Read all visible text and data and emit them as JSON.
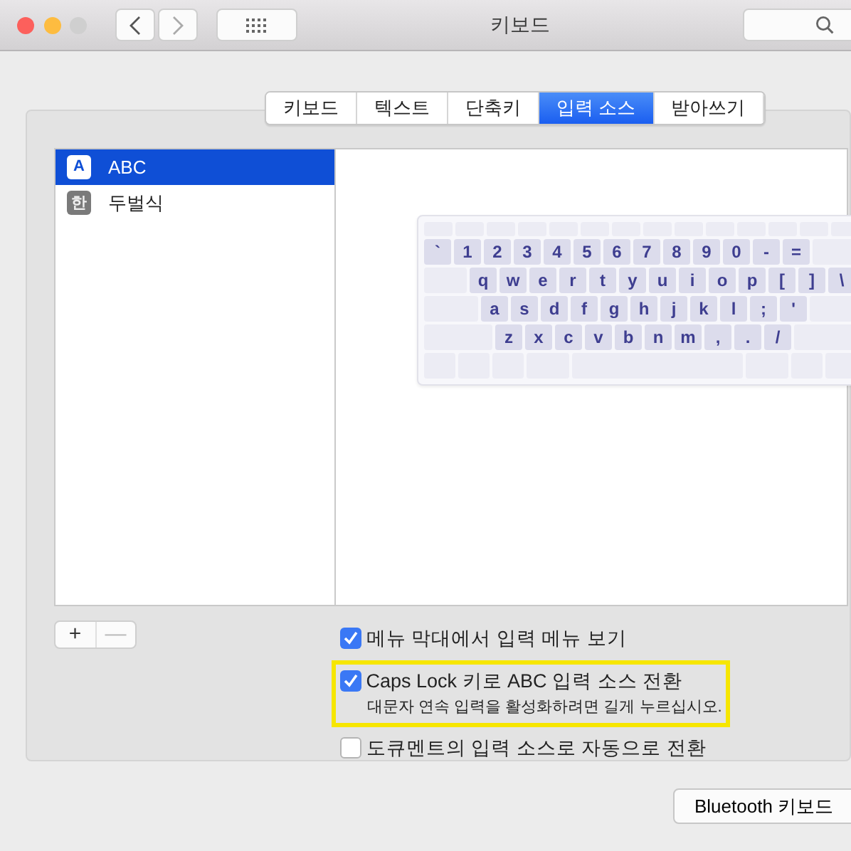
{
  "window": {
    "title": "키보드"
  },
  "tabs": [
    {
      "label": "키보드",
      "selected": false
    },
    {
      "label": "텍스트",
      "selected": false
    },
    {
      "label": "단축키",
      "selected": false
    },
    {
      "label": "입력 소스",
      "selected": true
    },
    {
      "label": "받아쓰기",
      "selected": false
    }
  ],
  "input_sources": [
    {
      "icon": "A",
      "name": "ABC",
      "selected": true
    },
    {
      "icon": "한",
      "name": "두벌식",
      "selected": false
    }
  ],
  "keyboard": {
    "rows": [
      [
        "`",
        "1",
        "2",
        "3",
        "4",
        "5",
        "6",
        "7",
        "8",
        "9",
        "0",
        "-",
        "="
      ],
      [
        "q",
        "w",
        "e",
        "r",
        "t",
        "y",
        "u",
        "i",
        "o",
        "p",
        "[",
        "]",
        "\\"
      ],
      [
        "a",
        "s",
        "d",
        "f",
        "g",
        "h",
        "j",
        "k",
        "l",
        ";",
        "'"
      ],
      [
        "z",
        "x",
        "c",
        "v",
        "b",
        "n",
        "m",
        ",",
        ".",
        "/"
      ]
    ]
  },
  "list_buttons": [
    "+",
    "—"
  ],
  "options": [
    {
      "label": "메뉴 막대에서 입력 메뉴 보기",
      "checked": true,
      "highlighted": false
    },
    {
      "label": "Caps Lock 키로 ABC 입력 소스 전환",
      "checked": true,
      "highlighted": true,
      "note": "대문자 연속 입력을 활성화하려면 길게 누르십시오."
    },
    {
      "label": "도큐멘트의 입력 소스로 자동으로 전환",
      "checked": false,
      "highlighted": false
    }
  ],
  "footer_button": "Bluetooth 키보드"
}
